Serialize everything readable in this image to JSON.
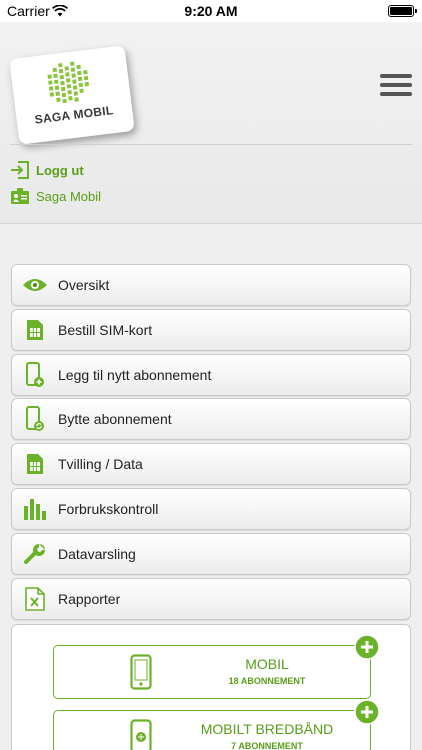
{
  "status_bar": {
    "carrier": "Carrier",
    "time": "9:20 AM"
  },
  "header": {
    "logo_text": "SAGA MOBIL",
    "logout_label": "Logg ut",
    "account_label": "Saga Mobil"
  },
  "menu": {
    "items": [
      {
        "label": "Oversikt",
        "icon": "eye-icon"
      },
      {
        "label": "Bestill SIM-kort",
        "icon": "sim-card-icon"
      },
      {
        "label": "Legg til nytt abonnement",
        "icon": "phone-add-icon"
      },
      {
        "label": "Bytte abonnement",
        "icon": "phone-swap-icon"
      },
      {
        "label": "Tvilling / Data",
        "icon": "sim-card-icon"
      },
      {
        "label": "Forbrukskontroll",
        "icon": "bar-chart-icon"
      },
      {
        "label": "Datavarsling",
        "icon": "wrench-icon"
      },
      {
        "label": "Rapporter",
        "icon": "excel-file-icon"
      }
    ]
  },
  "subscriptions": {
    "mobil": {
      "title": "MOBIL",
      "count": "18 ABONNEMENT"
    },
    "broadband": {
      "title": "MOBILT BREDBÅND",
      "count": "7 ABONNEMENT"
    }
  },
  "colors": {
    "accent": "#6bb22a",
    "accent_text": "#5a9e1a"
  }
}
